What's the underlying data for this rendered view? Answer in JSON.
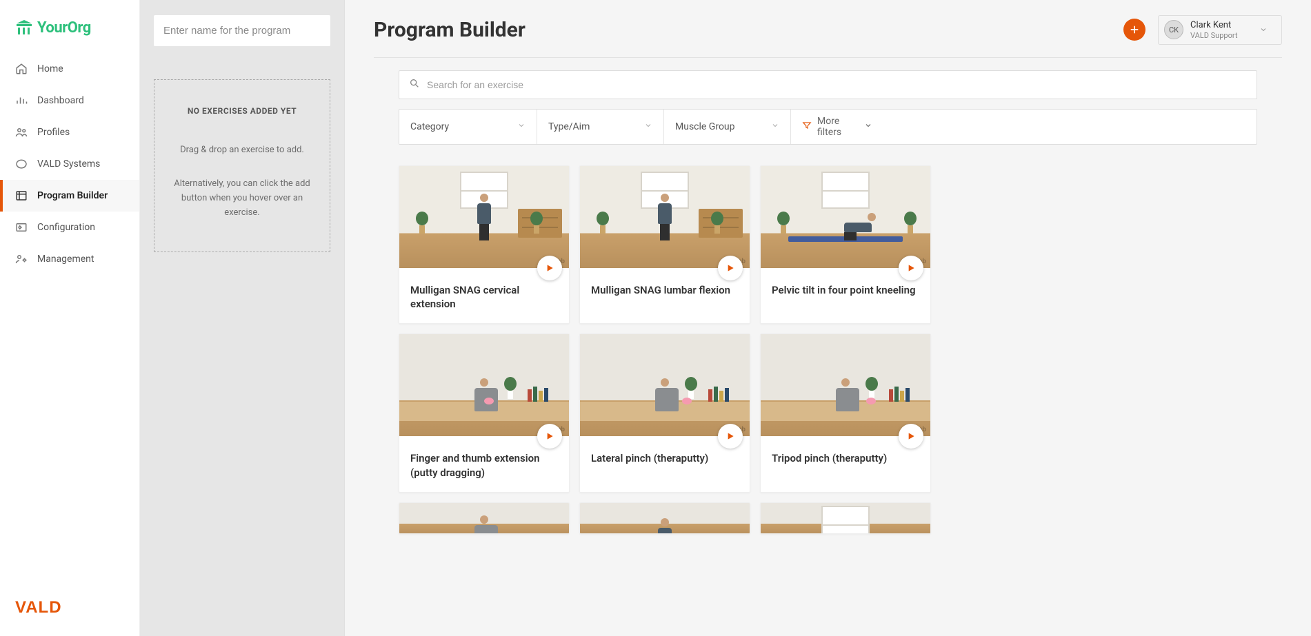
{
  "brand": {
    "org_name": "YourOrg",
    "footer_brand": "VALD"
  },
  "sidebar": {
    "items": [
      {
        "label": "Home"
      },
      {
        "label": "Dashboard"
      },
      {
        "label": "Profiles"
      },
      {
        "label": "VALD Systems"
      },
      {
        "label": "Program Builder"
      },
      {
        "label": "Configuration"
      },
      {
        "label": "Management"
      }
    ]
  },
  "program_panel": {
    "name_placeholder": "Enter name for the program",
    "dropzone_title": "NO EXERCISES ADDED YET",
    "dropzone_sub": "Drag & drop an exercise to add.",
    "dropzone_sub2": "Alternatively, you can click the add button when you hover over an exercise."
  },
  "header": {
    "page_title": "Program Builder",
    "user_initials": "CK",
    "user_name": "Clark Kent",
    "user_role": "VALD Support"
  },
  "search": {
    "placeholder": "Search for an exercise"
  },
  "filters": {
    "category": "Category",
    "type_aim": "Type/Aim",
    "muscle_group": "Muscle Group",
    "more": "More filters"
  },
  "exercises": [
    {
      "title": "Mulligan SNAG cervical extension"
    },
    {
      "title": "Mulligan SNAG lumbar flexion"
    },
    {
      "title": "Pelvic tilt in four point kneeling"
    },
    {
      "title": "Finger and thumb extension (putty dragging)"
    },
    {
      "title": "Lateral pinch (theraputty)"
    },
    {
      "title": "Tripod pinch (theraputty)"
    }
  ],
  "watermark": "ehab"
}
